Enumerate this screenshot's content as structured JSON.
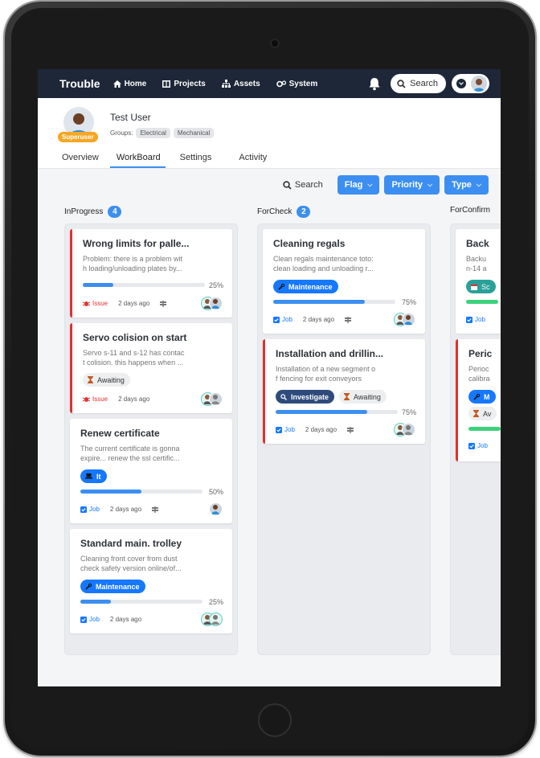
{
  "nav": {
    "brand": "Trouble",
    "items": [
      {
        "label": "Home",
        "icon": "home-icon"
      },
      {
        "label": "Projects",
        "icon": "projects-icon"
      },
      {
        "label": "Assets",
        "icon": "assets-icon"
      },
      {
        "label": "System",
        "icon": "system-icon"
      }
    ],
    "search_label": "Search"
  },
  "profile": {
    "name": "Test User",
    "badge": "Superuser",
    "groups_label": "Groups:",
    "groups": [
      "Electrical",
      "Mechanical"
    ]
  },
  "tabs": [
    "Overview",
    "WorkBoard",
    "Settings",
    "Activity"
  ],
  "active_tab": "WorkBoard",
  "toolbar": {
    "search_label": "Search",
    "filters": [
      "Flag",
      "Priority",
      "Type"
    ]
  },
  "columns": [
    {
      "name": "InProgress",
      "count": "4",
      "cards": [
        {
          "title": "Wrong limits for palle...",
          "desc1": "Problem: there is a problem wit",
          "desc2": "h loading/unloading plates by...",
          "progress_pct": "25%",
          "progress": 0.25,
          "kind": "Issue",
          "time": "2 days ago"
        },
        {
          "title": "Servo colision on start",
          "desc1": "Servo s-11 and s-12 has contac",
          "desc2": "t colision. this happens when ...",
          "tag": "Awaiting",
          "kind": "Issue",
          "time": "2 days ago"
        },
        {
          "title": "Renew certificate",
          "desc1": "The current certificate is gonna",
          "desc2": "expire... renew the ssl certific...",
          "tag": "It",
          "progress_pct": "50%",
          "progress": 0.5,
          "kind": "Job",
          "time": "2 days ago"
        },
        {
          "title": "Standard main. trolley",
          "desc1": "Cleaning front cover from dust",
          "desc2": "check safety version online/of...",
          "tag": "Maintenance",
          "progress_pct": "25%",
          "progress": 0.25,
          "kind": "Job",
          "time": "2 days ago"
        }
      ]
    },
    {
      "name": "ForCheck",
      "count": "2",
      "cards": [
        {
          "title": "Cleaning regals",
          "desc1": "Clean regals maintenance toto:",
          "desc2": "clean loading and unloading r...",
          "tag": "Maintenance",
          "progress_pct": "75%",
          "progress": 0.75,
          "kind": "Job",
          "time": "2 days ago"
        },
        {
          "title": "Installation and drillin...",
          "desc1": "Installation of a new segment o",
          "desc2": "f fencing for exit conveyors",
          "tag": "Investigate",
          "tag2": "Awaiting",
          "progress_pct": "75%",
          "progress": 0.75,
          "kind": "Job",
          "time": "2 days ago"
        }
      ]
    },
    {
      "name": "ForConfirm",
      "cards": [
        {
          "title": "Back",
          "desc1": "Backu",
          "desc2": "n-14 a",
          "tag": "Sc",
          "kind": "Job"
        },
        {
          "title": "Peric",
          "desc1": "Perioc",
          "desc2": "calibra",
          "tag": "M",
          "tag2": "Av",
          "kind": "Job"
        }
      ]
    }
  ]
}
